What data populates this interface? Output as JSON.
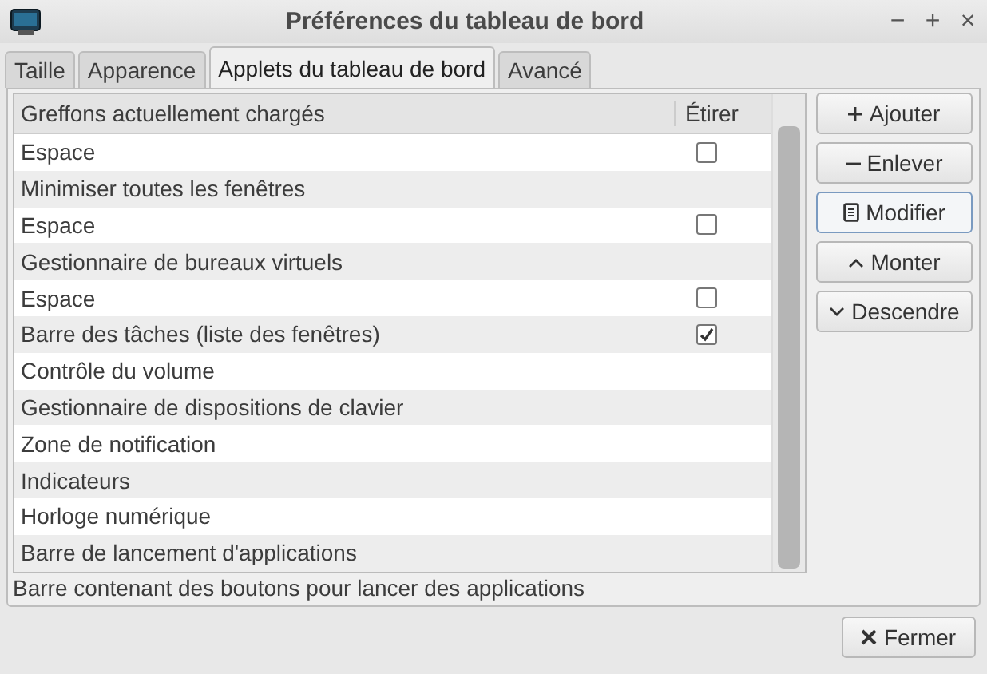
{
  "window": {
    "title": "Préférences du tableau de bord",
    "controls": [
      "−",
      "+",
      "×"
    ]
  },
  "tabs": [
    {
      "label": "Taille",
      "selected": false
    },
    {
      "label": "Apparence",
      "selected": false
    },
    {
      "label": "Applets du tableau de bord",
      "selected": true
    },
    {
      "label": "Avancé",
      "selected": false
    }
  ],
  "table": {
    "columns": [
      "Greffons actuellement chargés",
      "Étirer"
    ],
    "rows": [
      {
        "name": "Espace",
        "kind": "checkbox",
        "checked": false
      },
      {
        "name": "Minimiser toutes les fenêtres",
        "kind": "plain"
      },
      {
        "name": "Espace",
        "kind": "checkbox",
        "checked": false
      },
      {
        "name": "Gestionnaire de bureaux virtuels",
        "kind": "plain"
      },
      {
        "name": "Espace",
        "kind": "checkbox",
        "checked": false
      },
      {
        "name": "Barre des tâches (liste des fenêtres)",
        "kind": "checkbox",
        "checked": true
      },
      {
        "name": "Contrôle du volume",
        "kind": "plain"
      },
      {
        "name": "Gestionnaire de dispositions de clavier",
        "kind": "plain"
      },
      {
        "name": "Zone de notification",
        "kind": "plain"
      },
      {
        "name": "Indicateurs",
        "kind": "plain"
      },
      {
        "name": "Horloge numérique",
        "kind": "plain"
      },
      {
        "name": "Barre de lancement d'applications",
        "kind": "plain"
      }
    ]
  },
  "buttons": [
    {
      "label": "Ajouter",
      "kind": "plus",
      "focused": false
    },
    {
      "label": "Enlever",
      "kind": "minus",
      "focused": false
    },
    {
      "label": "Modifier",
      "kind": "document",
      "focused": true
    },
    {
      "label": "Monter",
      "kind": "up",
      "focused": false
    },
    {
      "label": "Descendre",
      "kind": "down",
      "focused": false
    }
  ],
  "description": "Barre contenant des boutons pour lancer des applications",
  "close_button": {
    "label": "Fermer"
  }
}
